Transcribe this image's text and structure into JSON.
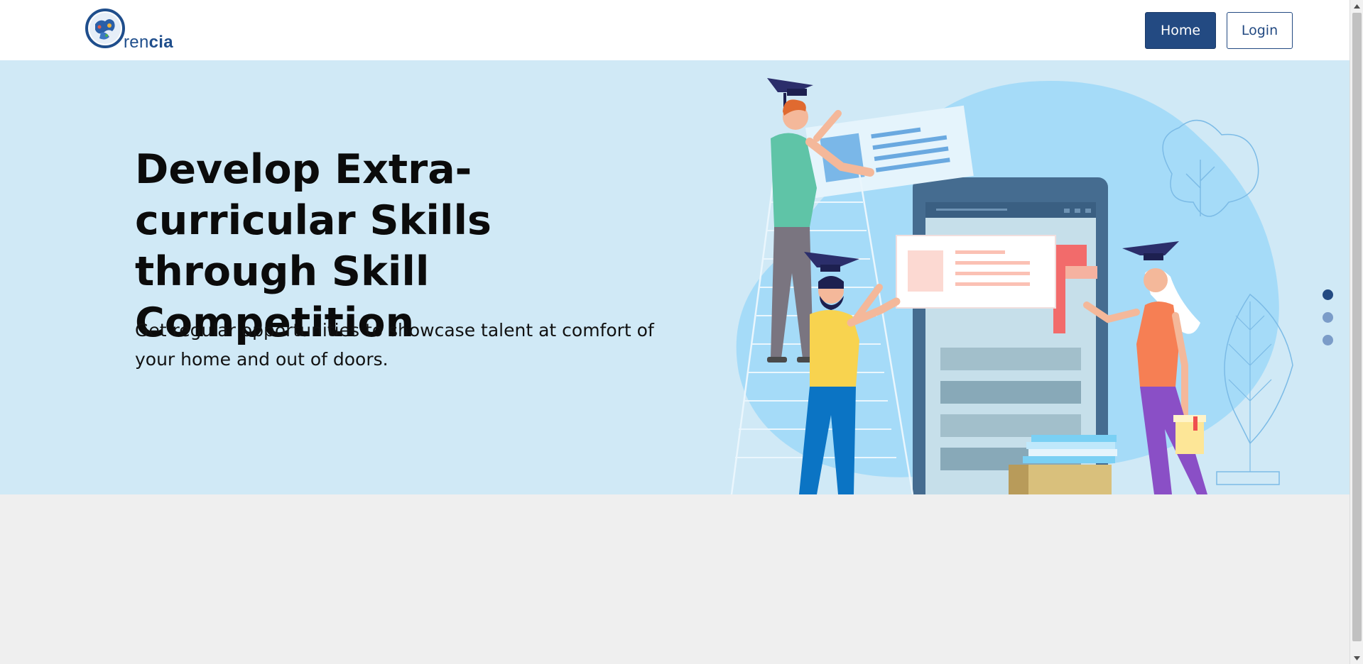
{
  "header": {
    "logo": {
      "prefix": "ren",
      "suffix": "cia",
      "icon": "globe-logo-icon"
    },
    "nav": {
      "home_label": "Home",
      "login_label": "Login"
    }
  },
  "hero": {
    "title": "Develop Extra-curricular Skills through Skill Competition",
    "subtitle": "Get regular opportunities to showcase talent at comfort of your home and out of doors.",
    "illustration": "students-graduation-illustration"
  },
  "carousel": {
    "slide_count": 3,
    "active_index": 0
  },
  "colors": {
    "primary": "#234a82",
    "hero_background": "#d0e9f6",
    "page_background": "#efefef",
    "blob": "#a5dbf8"
  }
}
